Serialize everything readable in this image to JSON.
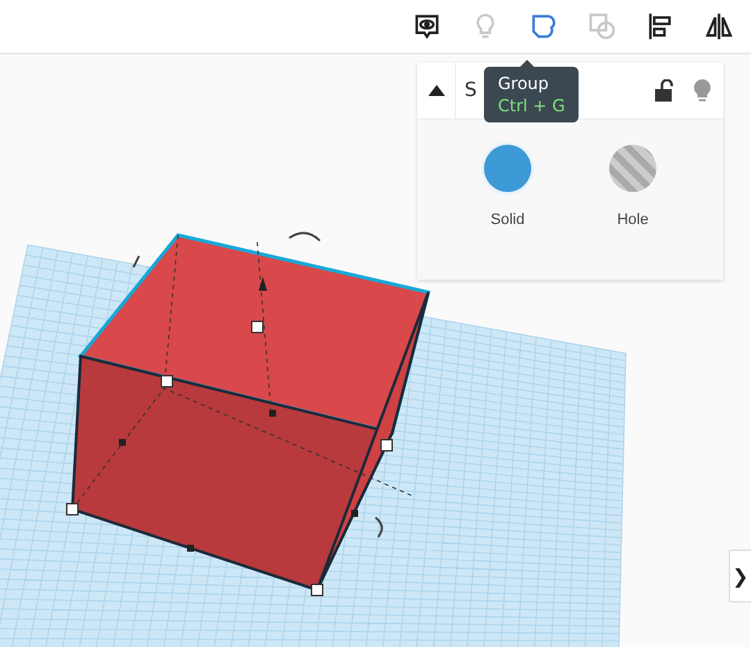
{
  "toolbar": {
    "tools": [
      {
        "kind": "notes",
        "disabled": false,
        "active": false
      },
      {
        "kind": "bulb",
        "disabled": true,
        "active": false
      },
      {
        "kind": "group",
        "disabled": false,
        "active": true
      },
      {
        "kind": "ungroup",
        "disabled": true,
        "active": false
      },
      {
        "kind": "align",
        "disabled": false,
        "active": false
      },
      {
        "kind": "mirror",
        "disabled": false,
        "active": false
      }
    ]
  },
  "tooltip": {
    "title": "Group",
    "shortcut": "Ctrl + G"
  },
  "inspector": {
    "title": "S",
    "expanded": true,
    "locked": false,
    "options": [
      {
        "label": "Solid",
        "kind": "solid",
        "selected": true
      },
      {
        "label": "Hole",
        "kind": "hole",
        "selected": false
      }
    ]
  },
  "side_toggle": {
    "label": "❯"
  }
}
